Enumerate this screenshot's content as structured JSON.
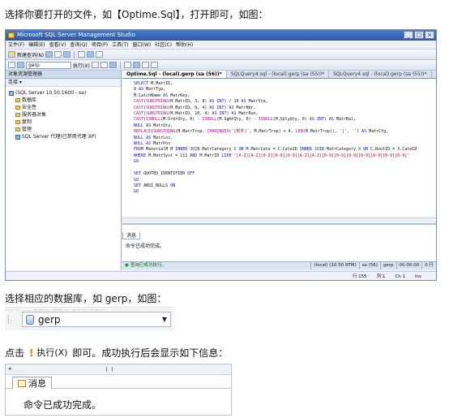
{
  "instructions": {
    "step1": "选择你要打开的文件，如【Optime.Sql】，打开即可，如图：",
    "step2": "选择相应的数据库，如 gerp，如图：",
    "step3_before": "点击",
    "step3_after": "即可。成功执行后会显示如下信息："
  },
  "ssms": {
    "title": "Microsoft SQL Server Management Studio",
    "window_buttons": [
      "_",
      "□",
      "×"
    ],
    "menu": [
      "文件(F)",
      "编辑(E)",
      "查看(V)",
      "查询(Q)",
      "项目(P)",
      "工具(T)",
      "窗口(W)",
      "社区(C)",
      "帮助(H)"
    ],
    "new_query": "新建查询(N)",
    "db_toolbar": "gerp",
    "execute_label": "执行(X)",
    "object_explorer": {
      "title": "对象资源管理器",
      "connect": "连接 ▾",
      "server": "(SQL Server 10.50.1600 - sa)",
      "nodes": [
        "数据库",
        "安全性",
        "服务器对象",
        "复制",
        "管理"
      ],
      "agent": "SQL Server 代理(已禁用代理 XP)"
    },
    "tabs": [
      "Optime.Sql - (local).gerp (sa (56))*",
      "SQLQuery4.sql - (local).gerp (sa (55))*",
      "SQLQuery4.sql - (local).gerp (sa (55))*"
    ],
    "code_lines": [
      "  SELECT M.MatrID,",
      "  0 AS MatrTyp,",
      "  M.CatchName AS MatrKey,",
      "  CAST(SUBSTRING(M.MatrID, 3, 8) AS INT) / 10 AS MatrSta,",
      "  CAST(SUBSTRING(M.MatrID, 6, 4) AS INT) AS MatrNbr,",
      "  CAST(SUBSTRING(M.MatrID, 10, 4) AS INT) AS MatrRun,",
      "  CAST(ISNULL(M.OrdrQty, 0) - ISNULL(M.SgmtQty, 0) - ISNULL(M.SplyQty, 0) AS INT) AS MatrBal,",
      "  NULL AS MatrQty,",
      "  REPLACE(SUBSTRING(M.MatrTrop, CHARINDEX('[附件]', M.MatrTrop) + 4, LEN(M.MatrTrop)), '[', '') AS MatrCfg,",
      "  NULL AS MatrLoc,",
      "  NULL AS MatrPos",
      "  FROM MaterialM M INNER JOIN MatrCategory C ON M.MatrCate = C.CateID INNER JOIN MatrCategory X ON C.RootID = X.CateID",
      "  WHERE M.MatrSyst = 111 AND M.MatrID LIKE '[A-Z][A-Z][0-9][0-9][0-9][A-Z][A-Z][0-9][0-9][0-9][0-9][0-9][0-9][0-9]'",
      "  GO",
      "",
      "  SET QUOTED_IDENTIFIER OFF",
      "  GO",
      "  SET ANSI_NULLS ON",
      "  GO"
    ],
    "results_tab": "消息",
    "results_message": "命令已成功完成。",
    "status_ok": "查询已成功执行。",
    "status_cells": [
      "(local) (10.50 RTM)",
      "sa (56)",
      "gerp",
      "00:00:00",
      "0 行"
    ],
    "bottom": [
      "行 155",
      "列 1",
      "Ch 1",
      "Ins"
    ]
  },
  "db_select": {
    "value": "gerp",
    "ghost": "SQL Server  查询(Q)  项目(P)  调试(D)  工具(T)"
  },
  "execute_button": {
    "label": "执行(X)"
  },
  "messages_panel": {
    "tab_label": "消息",
    "scroll_left": "◂",
    "message": "命令已成功完成。"
  }
}
